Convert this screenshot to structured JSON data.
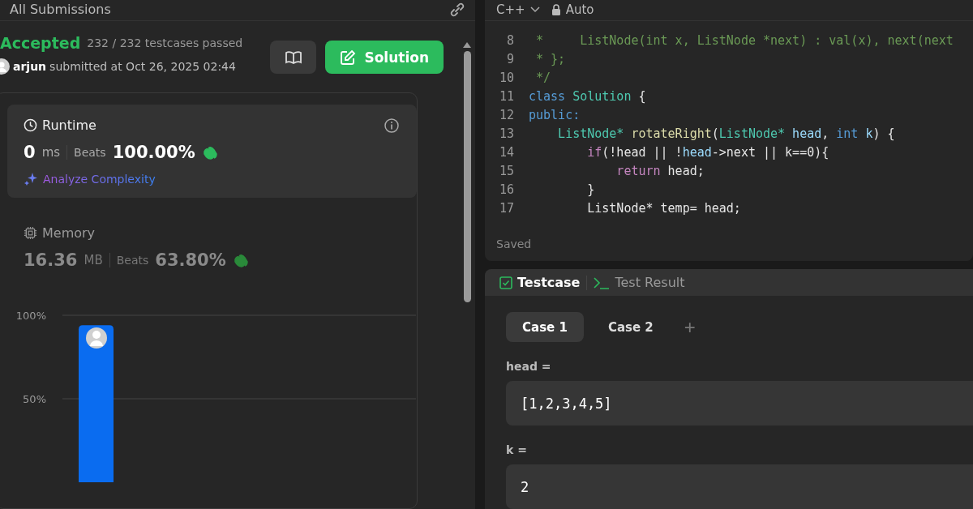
{
  "left_panel": {
    "title": "All Submissions",
    "status": {
      "label": "Accepted",
      "detail": "232 / 232 testcases passed"
    },
    "submitter": {
      "name": "arjun",
      "text": "submitted at Oct 26, 2025 02:44"
    },
    "solution_button": "Solution",
    "runtime": {
      "title": "Runtime",
      "value": "0",
      "unit": "ms",
      "beats_label": "Beats",
      "beats": "100.00%",
      "analyze": "Analyze Complexity",
      "selected": true
    },
    "memory": {
      "title": "Memory",
      "value": "16.36",
      "unit": "MB",
      "beats_label": "Beats",
      "beats": "63.80%",
      "selected": false
    },
    "chart_data": {
      "type": "bar",
      "ylim": [
        0,
        100
      ],
      "values": [
        94
      ],
      "yticks": [
        {
          "value": 50,
          "label": "50%"
        },
        {
          "value": 100,
          "label": "100%"
        }
      ]
    }
  },
  "editor": {
    "language": "C++",
    "mode": "Auto",
    "status": "Saved",
    "lines": [
      {
        "number": "8",
        "segments": [
          {
            "text": " *     ListNode(int x, ListNode *next) : val(x), next(next",
            "kind": "comment"
          }
        ]
      },
      {
        "number": "9",
        "segments": [
          {
            "text": " * };",
            "kind": "comment"
          }
        ]
      },
      {
        "number": "10",
        "segments": [
          {
            "text": " */",
            "kind": "comment"
          }
        ]
      },
      {
        "number": "11",
        "segments": [
          {
            "text": "class",
            "kind": "keyword"
          },
          {
            "text": " Solution",
            "kind": "type"
          },
          {
            "text": " {",
            "kind": "plain"
          }
        ]
      },
      {
        "number": "12",
        "segments": [
          {
            "text": "public:",
            "kind": "keyword"
          }
        ]
      },
      {
        "number": "13",
        "segments": [
          {
            "text": "    ListNode*",
            "kind": "type"
          },
          {
            "text": " rotateRight",
            "kind": "func"
          },
          {
            "text": "(",
            "kind": "plain"
          },
          {
            "text": "ListNode*",
            "kind": "type"
          },
          {
            "text": " head",
            "kind": "param"
          },
          {
            "text": ", ",
            "kind": "plain"
          },
          {
            "text": "int",
            "kind": "keyword"
          },
          {
            "text": " k",
            "kind": "param"
          },
          {
            "text": ") {",
            "kind": "plain"
          }
        ]
      },
      {
        "number": "14",
        "segments": [
          {
            "text": "        if",
            "kind": "control"
          },
          {
            "text": "(!head || !",
            "kind": "plain"
          },
          {
            "text": "head",
            "kind": "param"
          },
          {
            "text": "->next || k==0){",
            "kind": "plain"
          }
        ]
      },
      {
        "number": "15",
        "segments": [
          {
            "text": "            return",
            "kind": "control"
          },
          {
            "text": " head;",
            "kind": "plain"
          }
        ]
      },
      {
        "number": "16",
        "segments": [
          {
            "text": "        }",
            "kind": "plain"
          }
        ]
      },
      {
        "number": "17",
        "segments": [
          {
            "text": "        ListNode* temp= head;",
            "kind": "plain"
          }
        ]
      }
    ]
  },
  "console": {
    "tabs": [
      {
        "label": "Testcase",
        "selected": true
      },
      {
        "label": "Test Result",
        "selected": false
      }
    ],
    "cases": [
      {
        "label": "Case 1",
        "selected": true
      },
      {
        "label": "Case 2",
        "selected": false
      }
    ],
    "add_case": "+",
    "inputs": [
      {
        "name": "head =",
        "value": "[1,2,3,4,5]"
      },
      {
        "name": "k =",
        "value": "2"
      }
    ]
  }
}
